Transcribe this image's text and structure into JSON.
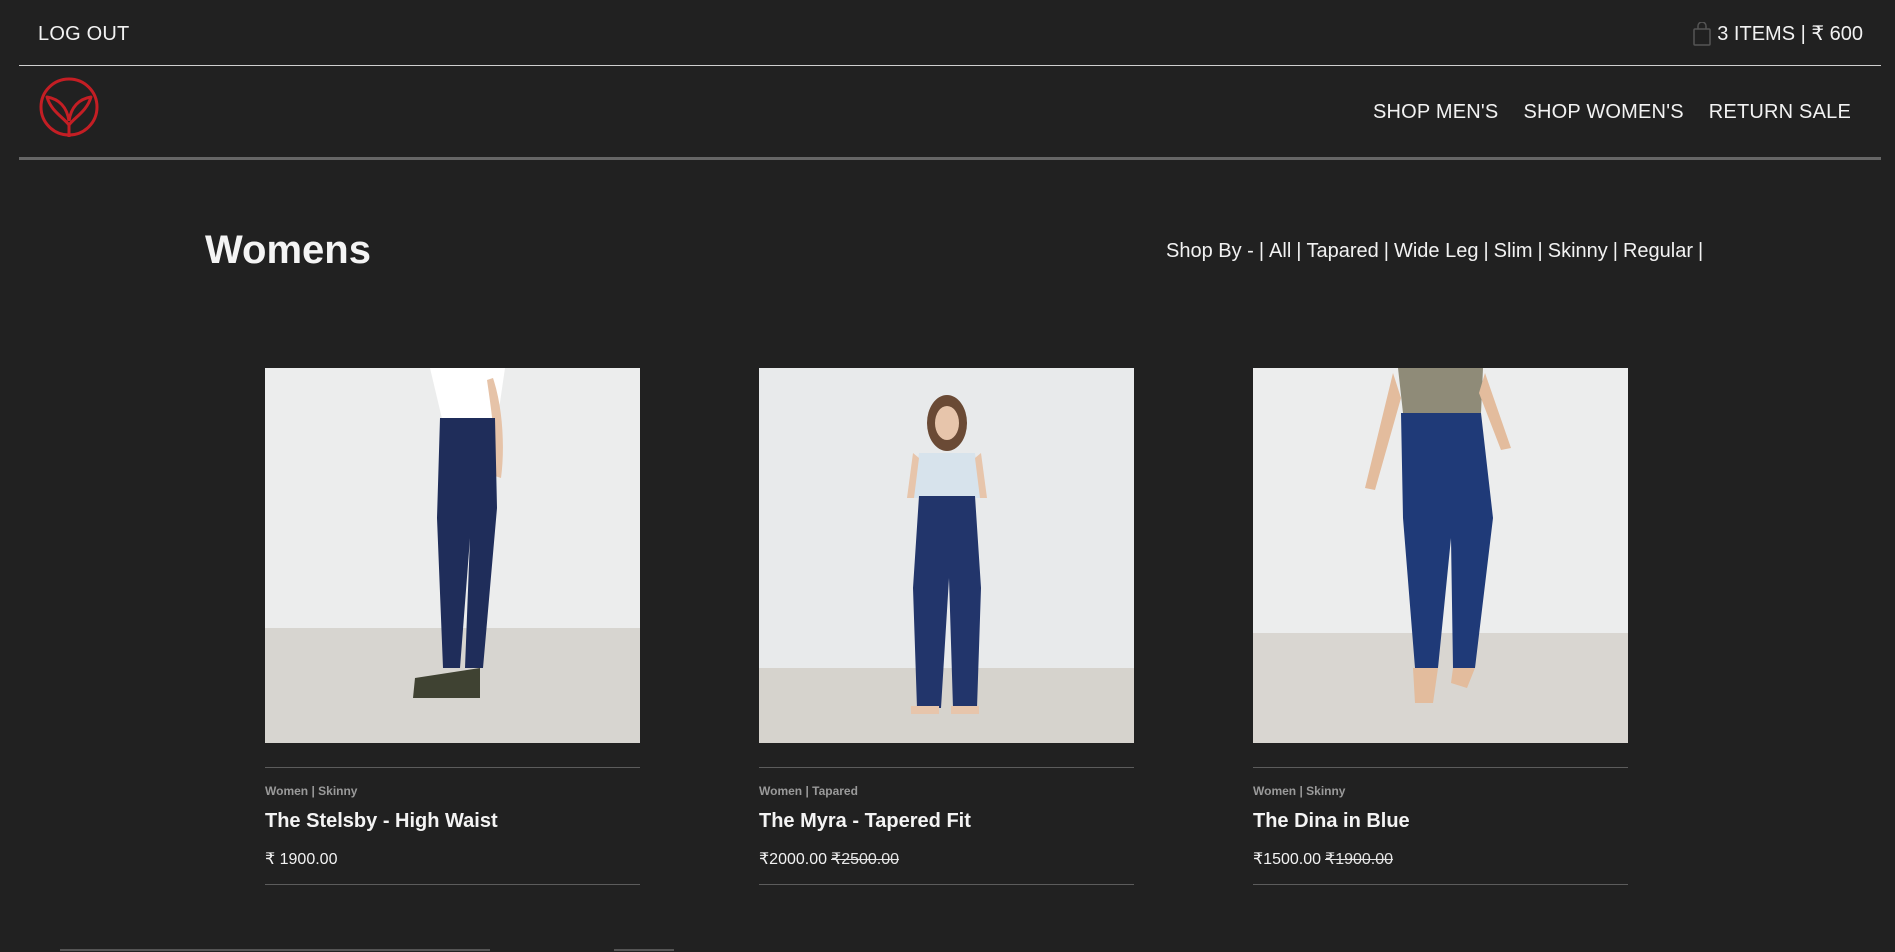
{
  "header": {
    "logout_label": "LOG OUT",
    "cart_summary": "3 ITEMS | ₹ 600",
    "cart_icon": "shopping-bag-icon"
  },
  "nav": {
    "logo_icon": "brand-leaf-logo",
    "brand_color": "#c41e24",
    "links": [
      "SHOP MEN'S",
      "SHOP WOMEN'S",
      "RETURN SALE"
    ]
  },
  "main": {
    "title": "Womens",
    "shop_by_label": "Shop By -",
    "filters": [
      "All",
      "Tapared",
      "Wide Leg",
      "Slim",
      "Skinny",
      "Regular"
    ]
  },
  "products": [
    {
      "category": "Women | Skinny",
      "name": "The Stelsby - High Waist",
      "price": "₹ 1900.00",
      "old_price": ""
    },
    {
      "category": "Women | Tapared",
      "name": "The Myra - Tapered Fit",
      "price": "₹2000.00",
      "old_price": "₹2500.00"
    },
    {
      "category": "Women | Skinny",
      "name": "The Dina in Blue",
      "price": "₹1500.00",
      "old_price": "₹1900.00"
    }
  ],
  "colors": {
    "background": "#212121",
    "text": "#f2f2f2",
    "denim": "#1f2d5a"
  }
}
